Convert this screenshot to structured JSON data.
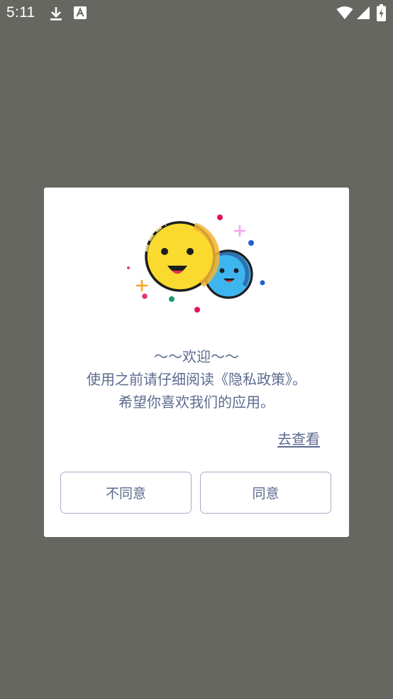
{
  "status_bar": {
    "time": "5:11",
    "icons": [
      "download-icon",
      "app-a-icon",
      "wifi-icon",
      "signal-icon",
      "battery-charging-icon"
    ]
  },
  "dialog": {
    "illustration": "smiley-faces-illustration",
    "title": "～～欢迎～～",
    "line1": "使用之前请仔细阅读《隐私政策》。",
    "line2": "希望你喜欢我们的应用。",
    "view_link": "去查看",
    "disagree_label": "不同意",
    "agree_label": "同意"
  },
  "colors": {
    "backdrop": "#676762",
    "dialog_bg": "#ffffff",
    "text": "#5d6b8f",
    "button_border": "#a6aec6",
    "yellow_face": "#f9d52c",
    "blue_face": "#4fc3f0"
  }
}
